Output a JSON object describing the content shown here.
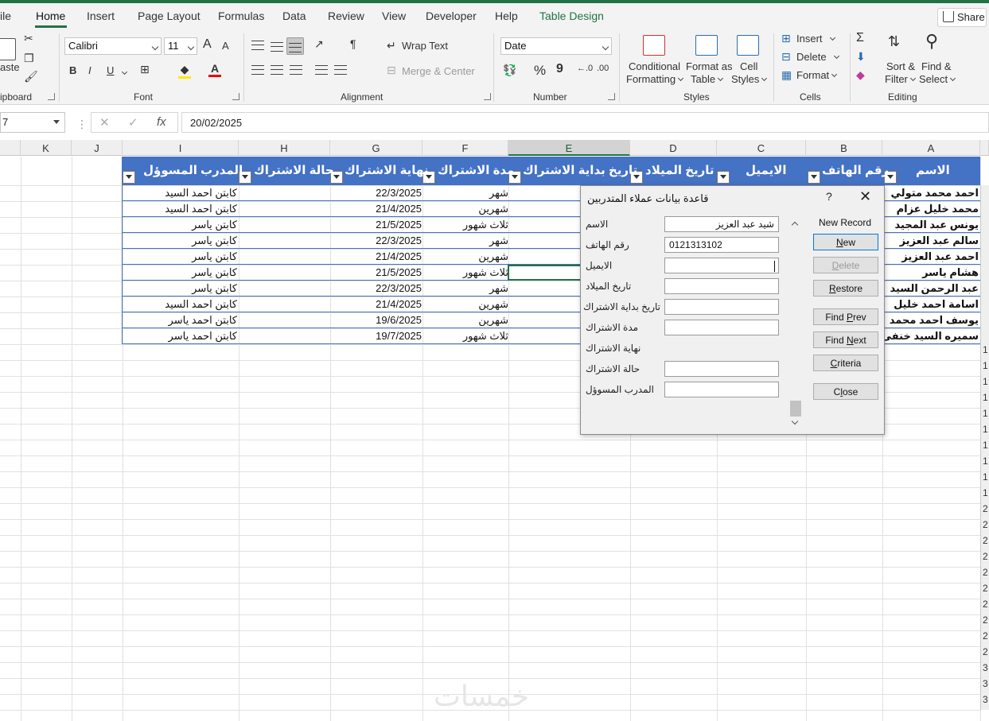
{
  "ribbon_tabs": [
    "ile",
    "Home",
    "Insert",
    "Page Layout",
    "Formulas",
    "Data",
    "Review",
    "View",
    "Developer",
    "Help",
    "Table Design"
  ],
  "share_label": "Share",
  "clipboard": {
    "paste_label": "aste",
    "group_label": "ipboard"
  },
  "font": {
    "name": "Calibri",
    "size": "11",
    "grow": "A",
    "shrink": "A",
    "bold": "B",
    "italic": "I",
    "underline": "U",
    "group_label": "Font"
  },
  "alignment": {
    "wrap_text": "Wrap Text",
    "merge_center": "Merge & Center",
    "group_label": "Alignment"
  },
  "number": {
    "format": "Date",
    "percent": "%",
    "comma": "9",
    "group_label": "Number"
  },
  "styles": {
    "conditional": [
      "Conditional",
      "Formatting"
    ],
    "format_table": [
      "Format as",
      "Table"
    ],
    "cell_styles": [
      "Cell",
      "Styles"
    ],
    "group_label": "Styles"
  },
  "cells": {
    "insert": "Insert",
    "delete": "Delete",
    "format": "Format",
    "group_label": "Cells"
  },
  "editing": {
    "sort": [
      "Sort &",
      "Filter"
    ],
    "find": [
      "Find &",
      "Select"
    ],
    "group_label": "Editing"
  },
  "name_box": "7",
  "formula_value": "20/02/2025",
  "columns": [
    "K",
    "J",
    "I",
    "H",
    "G",
    "F",
    "E",
    "D",
    "C",
    "B",
    "A"
  ],
  "table": {
    "headers": {
      "A": "الاسم",
      "B": "رقم الهاتف",
      "C": "الايميل",
      "D": "تاريخ الميلاد",
      "E": "تاريخ بداية الاشتراك",
      "F": "مدة الاشتراك",
      "G": "نهاية الاشتراك",
      "H": "حالة الاشتراك",
      "I": "المدرب المسوؤل"
    },
    "rows": [
      {
        "name": "احمد محمد متولي",
        "duration": "شهر",
        "end": "22/3/2025",
        "trainer": "كابتن احمد السيد"
      },
      {
        "name": "محمد خليل عزام",
        "duration": "شهرين",
        "end": "21/4/2025",
        "trainer": "كابتن احمد السيد"
      },
      {
        "name": "يونس عبد المجيد",
        "duration": "ثلاث شهور",
        "end": "21/5/2025",
        "trainer": "كابتن ياسر"
      },
      {
        "name": "سالم عبد العزيز",
        "duration": "شهر",
        "end": "22/3/2025",
        "trainer": "كابتن ياسر"
      },
      {
        "name": "احمد عبد العزيز",
        "duration": "شهرين",
        "end": "21/4/2025",
        "trainer": "كابتن ياسر"
      },
      {
        "name": "هشام ياسر",
        "duration": "ثلاث شهور",
        "end": "21/5/2025",
        "trainer": "كابتن ياسر"
      },
      {
        "name": "عبد الرحمن السيد",
        "duration": "شهر",
        "end": "22/3/2025",
        "trainer": "كابتن ياسر"
      },
      {
        "name": "اسامة احمد خليل",
        "duration": "شهرين",
        "end": "21/4/2025",
        "trainer": "كابتن احمد السيد"
      },
      {
        "name": "يوسف احمد محمد",
        "duration": "شهرين",
        "end": "19/6/2025",
        "trainer": "كابتن احمد ياسر"
      },
      {
        "name": "سميره السيد خنفى",
        "duration": "ثلاث شهور",
        "end": "19/7/2025",
        "trainer": "كابتن احمد ياسر"
      }
    ]
  },
  "row_numbers": [
    "",
    "",
    "",
    "",
    "",
    "",
    "",
    "",
    "",
    "",
    "1",
    "1",
    "1",
    "1",
    "1",
    "1",
    "1",
    "1",
    "1",
    "1",
    "2",
    "2",
    "2",
    "2",
    "2",
    "2",
    "2",
    "2",
    "2",
    "2",
    "3",
    "3",
    "3"
  ],
  "dialog": {
    "title": "قاعدة بيانات عملاء المتدربين",
    "help": "?",
    "record_label": "New Record",
    "fields": [
      {
        "label": "الاسم",
        "value": "شيد عبد العزيز",
        "has_input": true
      },
      {
        "label": "رقم الهاتف",
        "value": "0121313102",
        "has_input": true
      },
      {
        "label": "الايميل",
        "value": "",
        "has_input": true
      },
      {
        "label": "تاريخ الميلاد",
        "value": "",
        "has_input": true
      },
      {
        "label": "تاريخ بداية الاشتراك",
        "value": "",
        "has_input": true
      },
      {
        "label": "مدة الاشتراك",
        "value": "",
        "has_input": true
      },
      {
        "label": "نهاية الاشتراك",
        "value": "",
        "has_input": false
      },
      {
        "label": "حالة الاشتراك",
        "value": "",
        "has_input": true
      },
      {
        "label": "المدرب المسوؤل",
        "value": "",
        "has_input": true
      }
    ],
    "buttons": {
      "new": [
        "",
        "N",
        "ew"
      ],
      "delete": [
        "",
        "D",
        "elete"
      ],
      "restore": [
        "",
        "R",
        "estore"
      ],
      "find_prev": [
        "Find ",
        "P",
        "rev"
      ],
      "find_next": [
        "Find ",
        "N",
        "ext"
      ],
      "criteria": [
        "",
        "C",
        "riteria"
      ],
      "close": [
        "C",
        "l",
        "ose"
      ]
    }
  },
  "watermark": "خمسات",
  "colors": {
    "excel_green": "#217346",
    "table_header": "#4472c4"
  }
}
